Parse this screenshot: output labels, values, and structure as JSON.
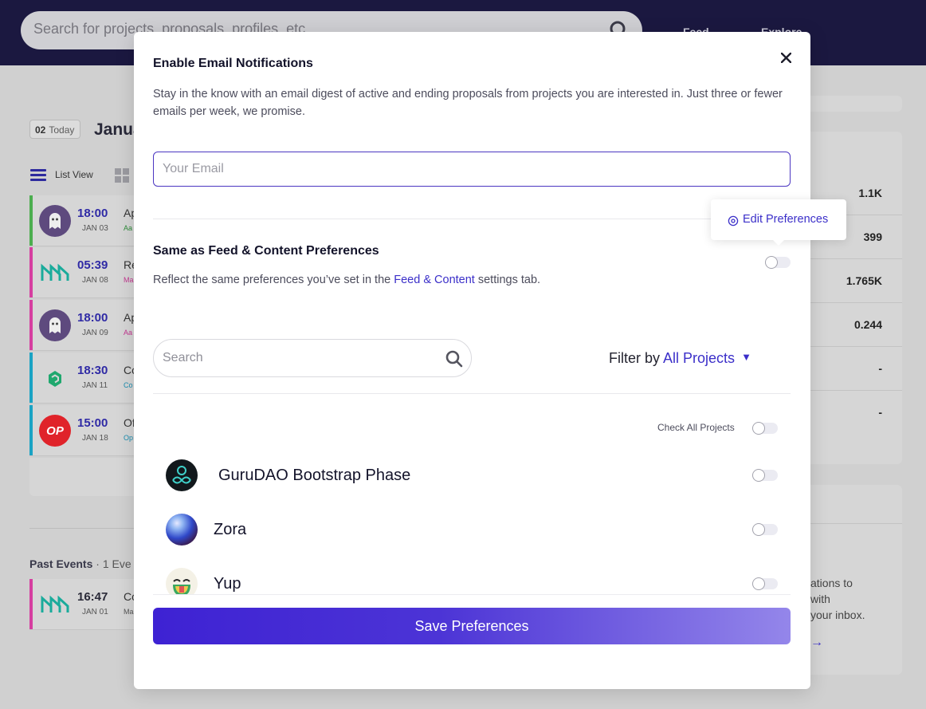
{
  "header": {
    "search_placeholder": "Search for projects, proposals, profiles, etc",
    "nav": [
      "Feed",
      "Explore"
    ]
  },
  "background": {
    "today_num": "02",
    "today_label": "Today",
    "month": "Janua",
    "list_view": "List View",
    "events": [
      {
        "time": "18:00",
        "date": "JAN 03",
        "t1": "Ap",
        "t2": "Aa",
        "bar": "#4cae4f",
        "t2color": "#2e8b3a"
      },
      {
        "time": "05:39",
        "date": "JAN 08",
        "t1": "Re",
        "t2": "Ma",
        "bar": "#d63ea0",
        "t2color": "#c2368f"
      },
      {
        "time": "18:00",
        "date": "JAN 09",
        "t1": "Ap",
        "t2": "Aa",
        "bar": "#d63ea0",
        "t2color": "#c2368f"
      },
      {
        "time": "18:30",
        "date": "JAN 11",
        "t1": "Co",
        "t2": "Co",
        "bar": "#1aa3c4",
        "t2color": "#1a8db0"
      },
      {
        "time": "15:00",
        "date": "JAN 18",
        "t1": "Of",
        "t2": "Op",
        "bar": "#1aa3c4",
        "t2color": "#1a8db0"
      }
    ],
    "past_events_label": "Past Events",
    "past_events_count": "· 1 Eve",
    "past_event": {
      "time": "16:47",
      "date": "JAN 01",
      "t1": "Co",
      "t2": "Ma"
    },
    "stats": [
      "1.1K",
      "399",
      "1.765K",
      "0.244",
      "-",
      "-"
    ],
    "side_lines": [
      "ations to",
      "with",
      "your inbox.",
      "→"
    ]
  },
  "modal": {
    "title": "Enable Email Notifications",
    "description": "Stay in the know with an email digest of active and ending proposals from projects you are interested in. Just three or fewer emails per week, we promise.",
    "email_placeholder": "Your Email",
    "edit_preferences": "Edit Preferences",
    "same_title": "Same as Feed & Content Preferences",
    "same_desc_prefix": "Reflect the same preferences you’ve set in the ",
    "same_desc_link": "Feed & Content",
    "same_desc_suffix": " settings tab.",
    "search_placeholder": "Search",
    "filter_label": "Filter by",
    "filter_value": "All Projects",
    "check_all_label": "Check All Projects",
    "projects": [
      {
        "name": "GuruDAO Bootstrap Phase"
      },
      {
        "name": "Zora"
      },
      {
        "name": "Yup"
      }
    ],
    "save_button": "Save Preferences"
  },
  "colors": {
    "accent": "#3b2fc9",
    "header_bg": "#1b1840"
  }
}
